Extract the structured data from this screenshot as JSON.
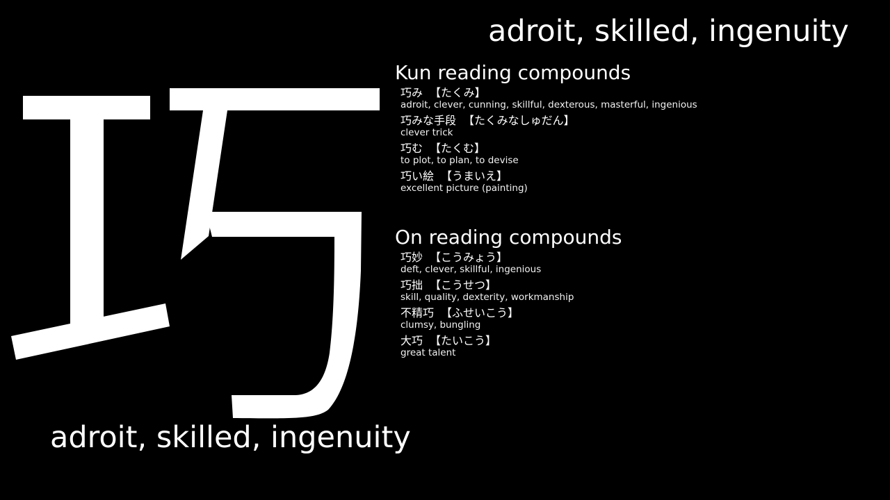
{
  "kanji": {
    "character": "巧",
    "glyph_color": "#ffffff"
  },
  "meaning": "adroit, skilled, ingenuity",
  "kun": {
    "title": "Kun reading compounds",
    "entries": [
      {
        "word": "巧み",
        "reading": "【たくみ】",
        "gloss": "adroit, clever, cunning, skillful, dexterous, masterful, ingenious"
      },
      {
        "word": "巧みな手段",
        "reading": "【たくみなしゅだん】",
        "gloss": "clever trick"
      },
      {
        "word": "巧む",
        "reading": "【たくむ】",
        "gloss": "to plot, to plan, to devise"
      },
      {
        "word": "巧い絵",
        "reading": "【うまいえ】",
        "gloss": "excellent picture (painting)"
      }
    ]
  },
  "on": {
    "title": "On reading compounds",
    "entries": [
      {
        "word": "巧妙",
        "reading": "【こうみょう】",
        "gloss": "deft, clever, skillful, ingenious"
      },
      {
        "word": "巧拙",
        "reading": "【こうせつ】",
        "gloss": "skill, quality, dexterity, workmanship"
      },
      {
        "word": "不精巧",
        "reading": "【ふせいこう】",
        "gloss": "clumsy, bungling"
      },
      {
        "word": "大巧",
        "reading": "【たいこう】",
        "gloss": "great talent"
      }
    ]
  },
  "colors": {
    "background": "#000000",
    "text": "#ffffff"
  }
}
